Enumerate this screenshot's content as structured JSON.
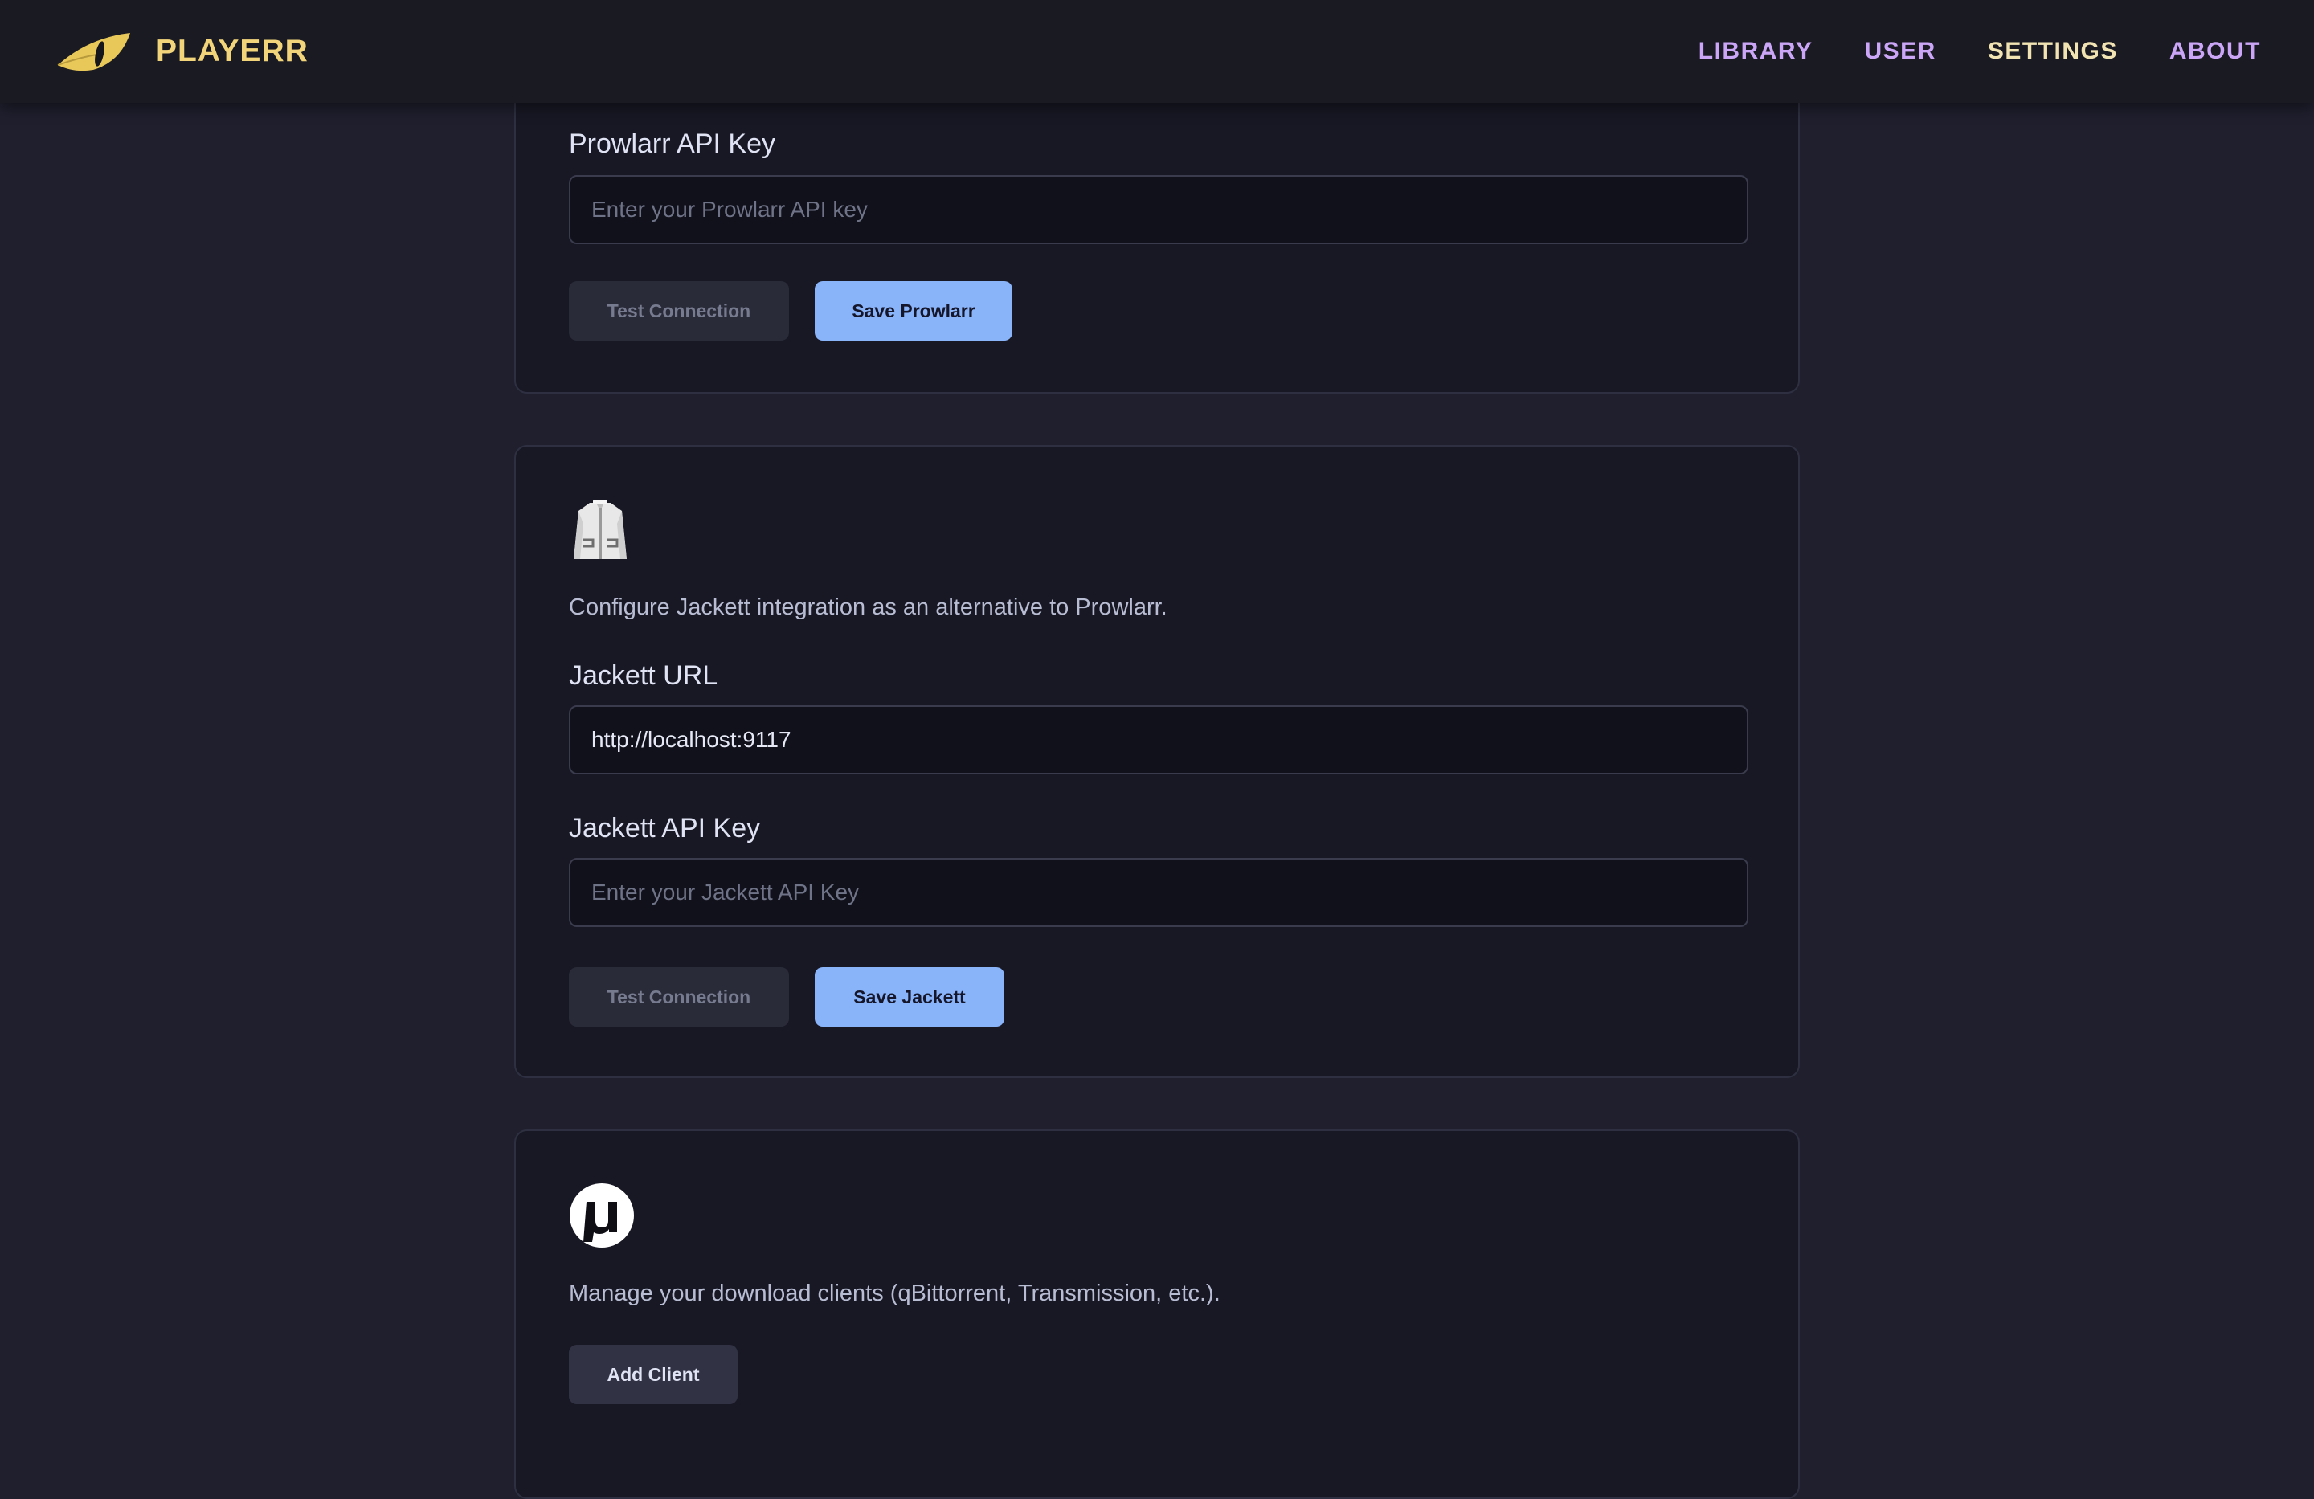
{
  "app": {
    "name": "PLAYERR"
  },
  "nav": {
    "library": "LIBRARY",
    "user": "USER",
    "settings": "SETTINGS",
    "about": "ABOUT"
  },
  "prowlarr": {
    "api_key_label": "Prowlarr API Key",
    "api_key_placeholder": "Enter your Prowlarr API key",
    "api_key_value": "",
    "test_label": "Test Connection",
    "save_label": "Save Prowlarr"
  },
  "jackett": {
    "icon": "jacket-icon",
    "description": "Configure Jackett integration as an alternative to Prowlarr.",
    "url_label": "Jackett URL",
    "url_value": "http://localhost:9117",
    "api_key_label": "Jackett API Key",
    "api_key_placeholder": "Enter your Jackett API Key",
    "api_key_value": "",
    "test_label": "Test Connection",
    "save_label": "Save Jackett"
  },
  "download_clients": {
    "icon": "utorrent-icon",
    "description": "Manage your download clients (qBittorrent, Transmission, etc.).",
    "add_label": "Add Client"
  },
  "colors": {
    "background": "#1f1f2e",
    "card": "#181825",
    "brand": "#f2d47a",
    "nav_link": "#cba6f7",
    "nav_active": "#f2e3b3",
    "primary_button": "#89b4fa"
  }
}
